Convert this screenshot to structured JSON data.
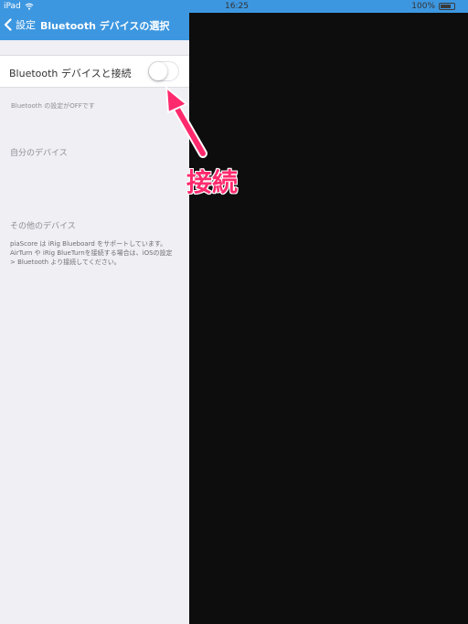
{
  "status_bar": {
    "device": "iPad",
    "time": "16:25",
    "battery": "100%"
  },
  "nav": {
    "back_label": "設定",
    "title": "Bluetooth デバイスの選択"
  },
  "bluetooth": {
    "toggle_label": "Bluetooth デバイスと接続",
    "toggle_on": false,
    "footnote": "Bluetooth の設定がOFFです"
  },
  "sections": {
    "my_devices": "自分のデバイス",
    "other_devices": "その他のデバイス"
  },
  "description": {
    "lines": [
      "piaScore は iRig Blueboard をサポートしています。",
      "AirTurn や iRig BlueTurnを接続する場合は、iOSの設定",
      "> Bluetooth より接続してください。"
    ]
  },
  "annotation": {
    "callout": "接続",
    "color": "#ff2a6d"
  },
  "colors": {
    "accent": "#3d97e0",
    "background": "#efeff4",
    "outside": "#0d0d0d"
  }
}
